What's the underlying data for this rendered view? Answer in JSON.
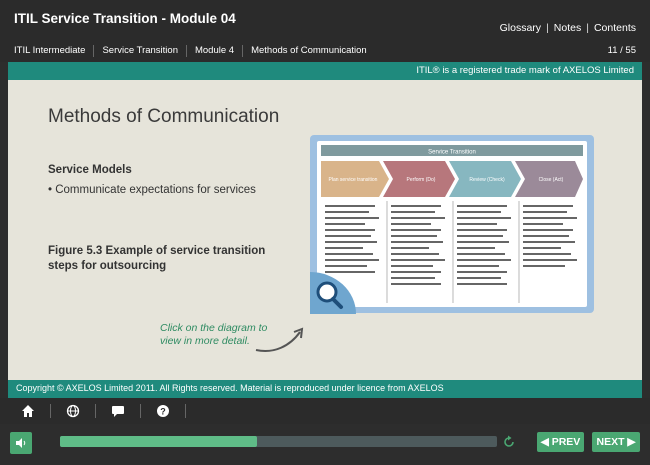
{
  "header": {
    "course_title": "ITIL Service Transition - Module 04",
    "links": [
      "Glossary",
      "Notes",
      "Contents"
    ],
    "breadcrumbs": [
      "ITIL Intermediate",
      "Service Transition",
      "Module 4",
      "Methods of Communication"
    ],
    "page_counter": "11 / 55"
  },
  "trademark": "ITIL® is a registered trade mark of AXELOS Limited",
  "main": {
    "title": "Methods of Communication",
    "section_heading": "Service Models",
    "bullet": "• Communicate expectations for services",
    "figure_caption": "Figure 5.3  Example of service transition steps for outsourcing",
    "hint": "Click on the diagram to view in more detail."
  },
  "diagram": {
    "banner": "Service Transition",
    "stages": [
      {
        "label": "Plan service transition",
        "color": "#d9b48a"
      },
      {
        "label": "Perform (Do)",
        "color": "#b7777c"
      },
      {
        "label": "Review (Check)",
        "color": "#87b7c0"
      },
      {
        "label": "Close (Act)",
        "color": "#9b8a99"
      }
    ]
  },
  "footer": {
    "copyright": "Copyright © AXELOS Limited 2011. All Rights reserved. Material is reproduced under licence from AXELOS",
    "icons": [
      "home-icon",
      "globe-icon",
      "chat-icon",
      "help-icon"
    ]
  },
  "controls": {
    "progress": 0.45,
    "prev_label": "◀ PREV",
    "next_label": "NEXT ▶"
  },
  "colors": {
    "teal": "#1f8a7d",
    "green": "#4aa772",
    "content_bg": "#e6e4da"
  }
}
